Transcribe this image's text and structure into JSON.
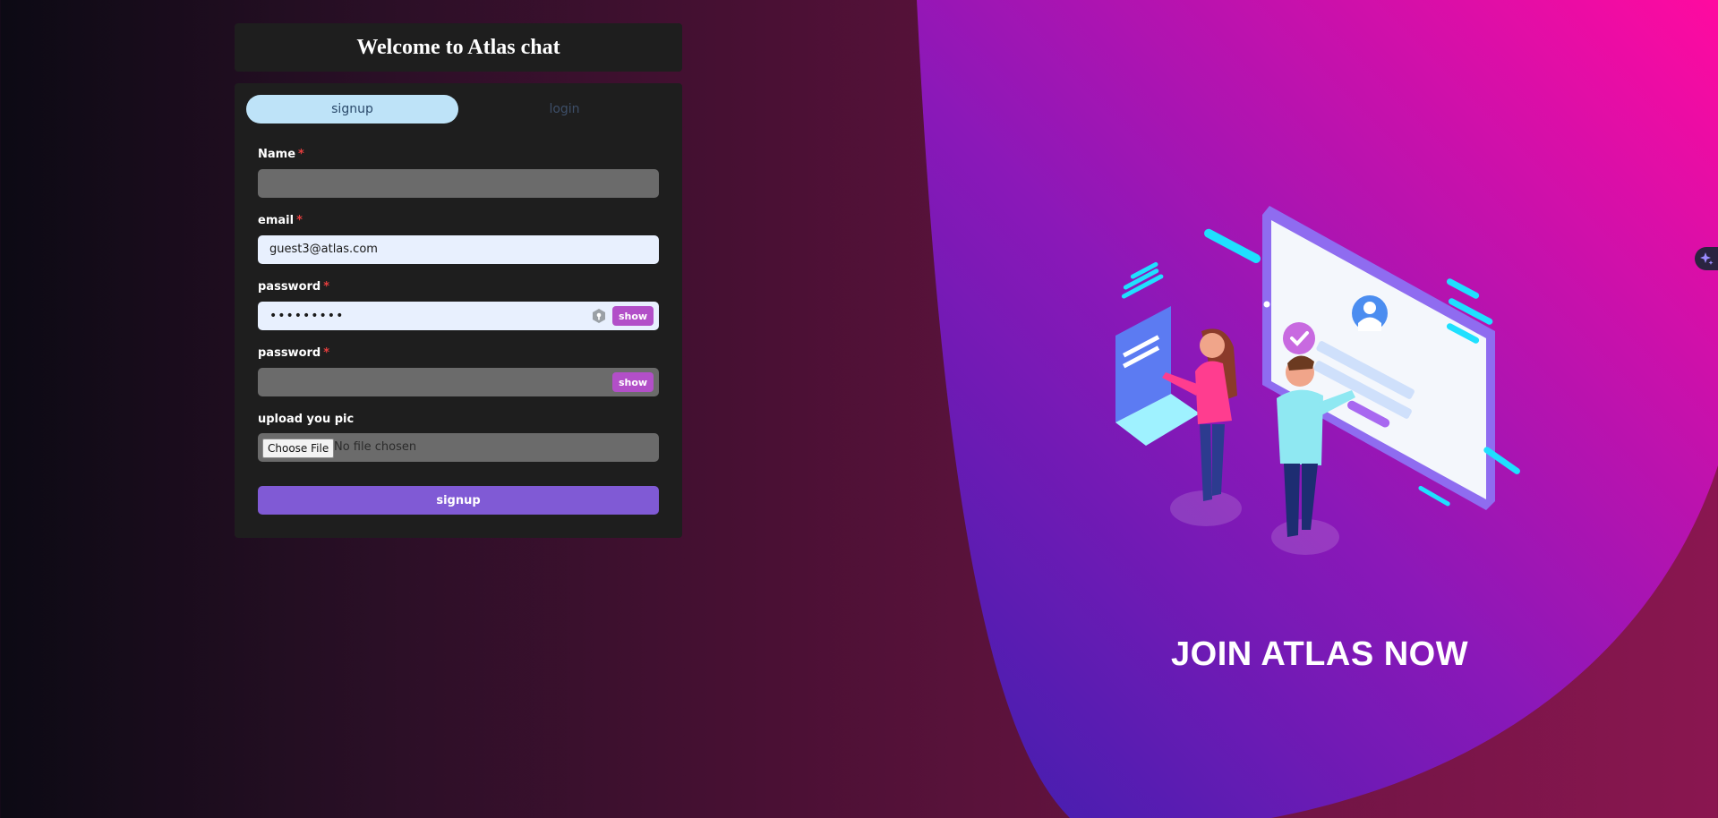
{
  "header": {
    "title": "Welcome to Atlas chat"
  },
  "tabs": [
    {
      "label": "signup",
      "active": true
    },
    {
      "label": "login",
      "active": false
    }
  ],
  "form": {
    "name": {
      "label": "Name",
      "required_mark": "*",
      "value": ""
    },
    "email": {
      "label": "email",
      "required_mark": "*",
      "value": "guest3@atlas.com"
    },
    "password": {
      "label": "password",
      "required_mark": "*",
      "value": "•••••••••",
      "show_label": "show"
    },
    "confirm_password": {
      "label": "password",
      "required_mark": "*",
      "value": "",
      "show_label": "show"
    },
    "upload": {
      "label": "upload you pic",
      "button_label": "Choose File",
      "status": "No file chosen"
    },
    "submit_label": "signup"
  },
  "hero": {
    "headline": "JOIN ATLAS NOW"
  },
  "colors": {
    "accent_purple": "#805ad5",
    "show_button": "#b24fc8",
    "active_tab": "#bee3f8",
    "required": "#e53e3e",
    "card_bg": "#1e1e1e"
  },
  "icons": [
    "key-icon",
    "person-icon",
    "checkmark-icon",
    "sparkle-icon"
  ]
}
